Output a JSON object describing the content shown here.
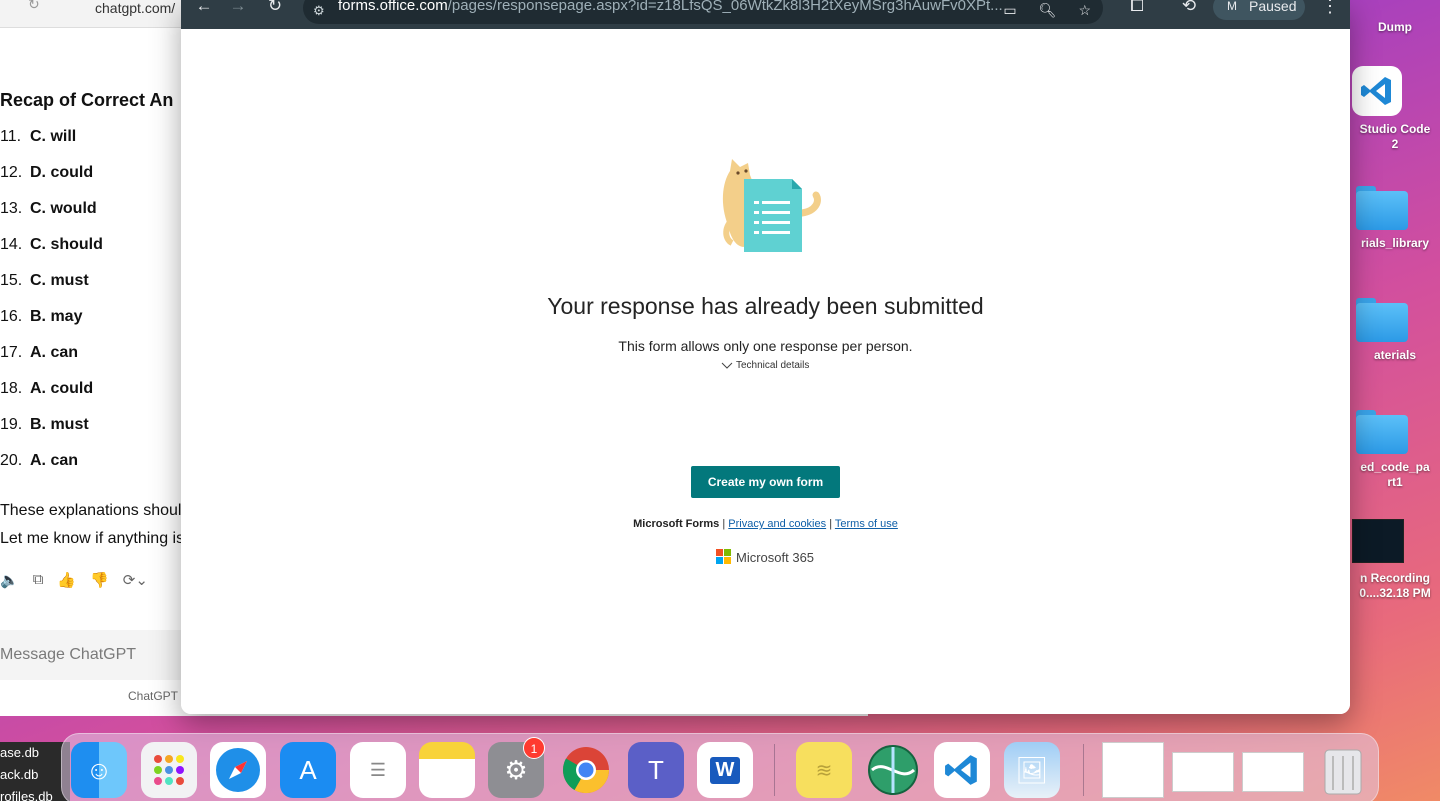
{
  "chatgpt": {
    "url": "chatgpt.com/",
    "recap_title": "Recap of Correct An",
    "answers": [
      {
        "num": "11.",
        "answer": "C. will"
      },
      {
        "num": "12.",
        "answer": "D. could"
      },
      {
        "num": "13.",
        "answer": "C. would"
      },
      {
        "num": "14.",
        "answer": "C. should"
      },
      {
        "num": "15.",
        "answer": "C. must"
      },
      {
        "num": "16.",
        "answer": "B. may"
      },
      {
        "num": "17.",
        "answer": "A. can"
      },
      {
        "num": "18.",
        "answer": "A. could"
      },
      {
        "num": "19.",
        "answer": "B. must"
      },
      {
        "num": "20.",
        "answer": "A. can"
      }
    ],
    "para1": "These explanations shoul",
    "para2": "Let me know if anything is",
    "message_placeholder": "Message ChatGPT",
    "footnote": "ChatGPT"
  },
  "side_files": [
    "ase.db",
    "ack.db",
    "rofiles.db"
  ],
  "browser": {
    "url_host": "forms.office.com",
    "url_path": "/pages/responsepage.aspx?id=z18LfsQS_06WtkZk8l3H2tXeyMSrg3hAuwFv0XPt...",
    "profile_initial": "M",
    "profile_status": "Paused"
  },
  "forms_page": {
    "headline": "Your response has already been submitted",
    "subtext": "This form allows only one response per person.",
    "technical_details": "Technical details",
    "create_button": "Create my own form",
    "footer_brand": "Microsoft Forms",
    "footer_sep": "|",
    "privacy_link": "Privacy and cookies",
    "terms_link": "Terms of use",
    "ms365_label": "Microsoft 365"
  },
  "desktop": {
    "items": [
      {
        "label": "Dump"
      },
      {
        "label": "Studio Code\n2"
      },
      {
        "label": "rials_library"
      },
      {
        "label": "aterials"
      },
      {
        "label": "ed_code_pa\nrt1"
      },
      {
        "label": "n Recording\n0....32.18 PM"
      }
    ]
  },
  "dock": {
    "settings_badge": "1",
    "apps": [
      "finder-icon",
      "launchpad-icon",
      "safari-icon",
      "app-store-icon",
      "reminders-icon",
      "notes-icon",
      "system-settings-icon",
      "chrome-icon",
      "teams-icon",
      "word-icon",
      "stickies-icon",
      "network-icon",
      "vscode-icon",
      "preview-icon",
      "trash-icon"
    ]
  },
  "colors": {
    "forms_teal": "#03787c",
    "browser_toolbar": "#2f3d45"
  }
}
